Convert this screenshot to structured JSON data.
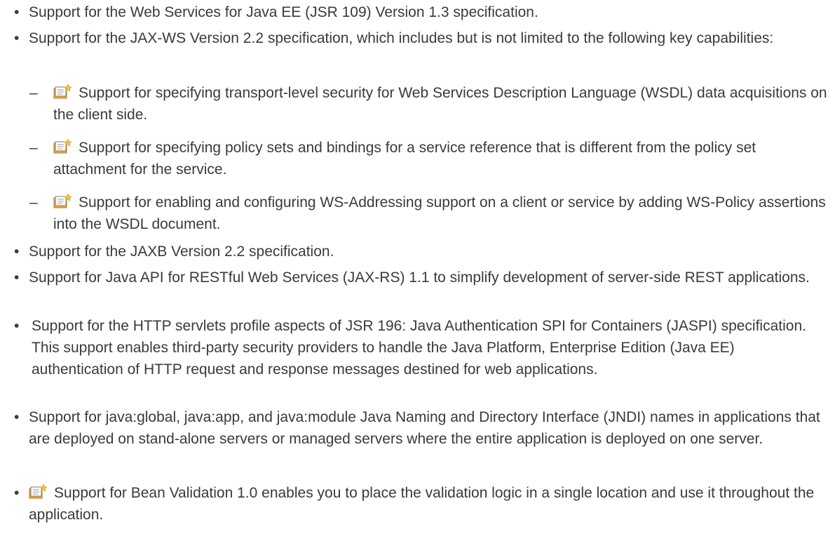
{
  "items": [
    {
      "text": "Support for the Web Services for Java EE (JSR 109) Version 1.3 specification."
    },
    {
      "text": "Support for the JAX-WS Version 2.2 specification, which includes but is not limited to the following key capabilities:"
    },
    {
      "text": "Support for specifying transport-level security for Web Services Description Language (WSDL) data acquisitions on the client side.",
      "icon": "new-feature-icon"
    },
    {
      "text": "Support for specifying policy sets and bindings for a service reference that is different from the policy set attachment for the service.",
      "icon": "new-feature-icon"
    },
    {
      "text": "Support for enabling and configuring WS-Addressing support on a client or service by adding WS-Policy assertions into the WSDL document.",
      "icon": "new-feature-icon"
    },
    {
      "text": "Support for the JAXB Version 2.2 specification."
    },
    {
      "text": "Support for Java API for RESTful Web Services (JAX-RS) 1.1 to simplify development of server-side REST applications."
    },
    {
      "text": "Support for the HTTP servlets profile aspects of JSR 196: Java Authentication SPI for Containers (JASPI) specification. This support enables third-party security providers to handle the Java Platform, Enterprise Edition (Java EE) authentication of HTTP request and response messages destined for web applications."
    },
    {
      "text": "Support for java:global, java:app, and java:module Java Naming and Directory Interface (JNDI) names in applications that are deployed on stand-alone servers or managed servers where the entire application is deployed on one server."
    },
    {
      "text": "Support for Bean Validation 1.0 enables you to place the validation logic in a single location and use it throughout the application.",
      "icon": "new-feature-icon"
    }
  ],
  "markers": {
    "bullet": "•",
    "dash": "–"
  },
  "colors": {
    "text": "#3a3a3a",
    "icon_folder": "#f4a53c",
    "icon_page": "#ffffff",
    "icon_border": "#7a7a7a",
    "icon_star": "#f2c230"
  }
}
